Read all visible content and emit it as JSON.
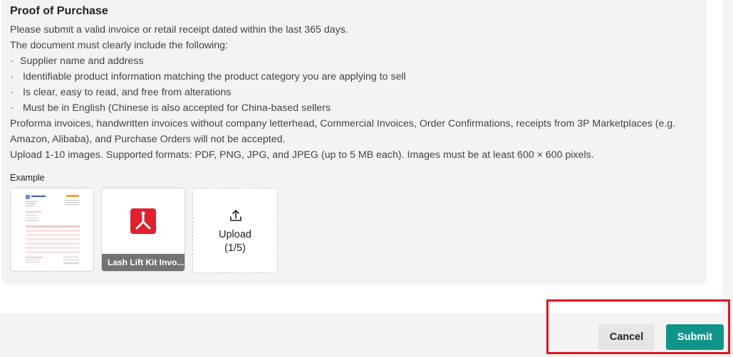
{
  "section": {
    "title": "Proof of Purchase",
    "intro": "Please submit a valid invoice or retail receipt dated within the last 365 days.",
    "must_include": "The document must clearly include the following:",
    "bullet_marker": "·",
    "bullets": [
      "Supplier name and address",
      " Identifiable product information matching the product category you are applying to sell",
      " Is clear, easy to read, and free from alterations",
      " Must be in English (Chinese is also accepted for China-based sellers"
    ],
    "not_accepted_1": "Proforma invoices, handwritten invoices without company letterhead, Commercial Invoices, Order Confirmations, receipts from 3P Marketplaces (e.g.",
    "not_accepted_2": "Amazon, Alibaba), and Purchase Orders will not be accepted.",
    "upload_rules": "Upload 1-10 images. Supported formats: PDF, PNG, JPG, and JPEG (up to 5 MB each). Images must be at least 600 × 600 pixels."
  },
  "example": {
    "label": "Example"
  },
  "files": [
    {
      "name": "Lash Lift Kit Invo...",
      "icon": "pdf-icon",
      "icon_color": "#e0202d"
    }
  ],
  "upload": {
    "label": "Upload",
    "count": "(1/5)",
    "icon": "upload-icon"
  },
  "footer": {
    "cancel_label": "Cancel",
    "submit_label": "Submit",
    "submit_color": "#10948a",
    "highlight_color": "#e0151e"
  }
}
